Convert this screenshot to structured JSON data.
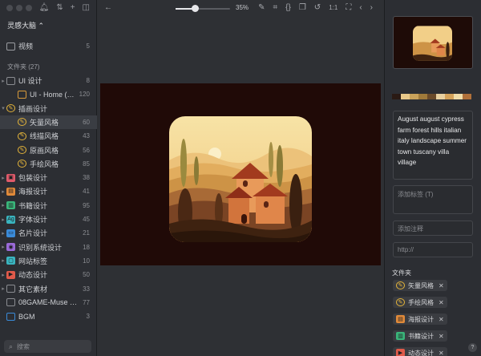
{
  "sidebar": {
    "library_title": "灵感大脑 ⌃",
    "video_label": "视频",
    "video_count": "5",
    "section_title": "文件夹 (27)",
    "folders": [
      {
        "label": "UI 设计",
        "count": "8",
        "icon": "folder-icon",
        "color": "#8a8c91",
        "level": 0,
        "caret": "▸"
      },
      {
        "label": "UI - Home (…",
        "count": "120",
        "icon": "folder-icon",
        "color": "#d89a3a",
        "level": 1,
        "caret": ""
      },
      {
        "label": "插画设计",
        "count": "",
        "icon": "brush-folder-icon",
        "color": "#e0b13a",
        "level": 0,
        "caret": "▾"
      },
      {
        "label": "矢量风格",
        "count": "60",
        "icon": "brush-folder-icon",
        "color": "#e0b13a",
        "level": 1,
        "caret": ""
      },
      {
        "label": "线描风格",
        "count": "43",
        "icon": "brush-folder-icon",
        "color": "#e0b13a",
        "level": 1,
        "caret": ""
      },
      {
        "label": "原画风格",
        "count": "56",
        "icon": "brush-folder-icon",
        "color": "#e0b13a",
        "level": 1,
        "caret": ""
      },
      {
        "label": "手绘风格",
        "count": "85",
        "icon": "brush-folder-icon",
        "color": "#e0b13a",
        "level": 1,
        "caret": ""
      },
      {
        "label": "包装设计",
        "count": "38",
        "icon": "box-icon",
        "color": "#e05a6a",
        "level": 0,
        "caret": "▸"
      },
      {
        "label": "海报设计",
        "count": "41",
        "icon": "poster-icon",
        "color": "#e08a3a",
        "level": 0,
        "caret": "▸"
      },
      {
        "label": "书籍设计",
        "count": "95",
        "icon": "book-icon",
        "color": "#3ab57a",
        "level": 0,
        "caret": "▸"
      },
      {
        "label": "字体设计",
        "count": "45",
        "icon": "font-icon",
        "color": "#3ab5c0",
        "level": 0,
        "caret": "▸"
      },
      {
        "label": "名片设计",
        "count": "21",
        "icon": "card-icon",
        "color": "#3a8ad8",
        "level": 0,
        "caret": "▸"
      },
      {
        "label": "识别系统设计",
        "count": "18",
        "icon": "eye-icon",
        "color": "#9a6ad8",
        "level": 0,
        "caret": "▸"
      },
      {
        "label": "网站标签",
        "count": "10",
        "icon": "monitor-icon",
        "color": "#3ab5c0",
        "level": 0,
        "caret": "▸"
      },
      {
        "label": "动态设计",
        "count": "50",
        "icon": "motion-icon",
        "color": "#e05a4a",
        "level": 0,
        "caret": "▸"
      },
      {
        "label": "其它素材",
        "count": "33",
        "icon": "folder-icon",
        "color": "#8a8c91",
        "level": 0,
        "caret": "▸"
      },
      {
        "label": "08GAME-Muse …",
        "count": "77",
        "icon": "folder-icon",
        "color": "#8a8c91",
        "level": 0,
        "caret": ""
      },
      {
        "label": "BGM",
        "count": "3",
        "icon": "folder-icon",
        "color": "#3a8ad8",
        "level": 0,
        "caret": ""
      }
    ],
    "active_index": 3,
    "search_placeholder": "搜索"
  },
  "toolbar": {
    "zoom": "35%",
    "zoom_fraction": 0.35,
    "ratio_label": "1:1"
  },
  "inspector": {
    "palette": [
      "#2a1a14",
      "#e9c98a",
      "#c9a25a",
      "#a07a3a",
      "#6a4a2a",
      "#e8d0a0",
      "#d4a25a",
      "#f0dca8",
      "#b0703a"
    ],
    "tags_text": "August august cypress farm forest hills italian italy landscape summer town tuscany villa village",
    "tag_placeholder": "添加标签 (T)",
    "note_placeholder": "添加注释",
    "url_placeholder": "http://",
    "folders_title": "文件夹",
    "folder_chips": [
      {
        "label": "矢量风格",
        "icon": "brush-folder-icon",
        "color": "#e0b13a"
      },
      {
        "label": "手绘风格",
        "icon": "brush-folder-icon",
        "color": "#e0b13a"
      },
      {
        "label": "海报设计",
        "icon": "poster-icon",
        "color": "#e08a3a"
      },
      {
        "label": "书籍设计",
        "icon": "book-icon",
        "color": "#3ab57a"
      },
      {
        "label": "动态设计",
        "icon": "motion-icon",
        "color": "#e05a4a"
      }
    ],
    "help_label": "?"
  }
}
